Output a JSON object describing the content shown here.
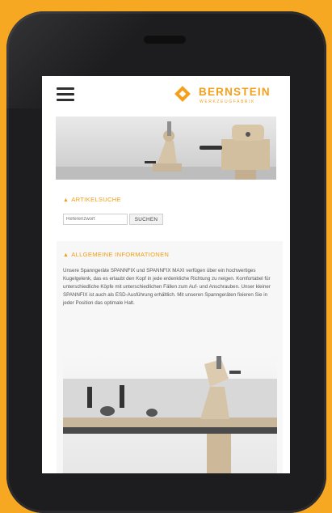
{
  "header": {
    "logo_name": "BERNSTEIN",
    "logo_tagline": "WERKZEUGFABRIK"
  },
  "search": {
    "title": "ARTIKELSUCHE",
    "placeholder": "Referenzwort",
    "button_label": "SUCHEN"
  },
  "info": {
    "title": "ALLGEMEINE INFORMATIONEN",
    "text": "Unsere Spanngeräte SPANNFIX und SPANNFIX MAXI verfügen über ein hochwertiges Kugelgelenk, das es erlaubt den Kopf in jede erdenkliche Richtung zu neigen. Komfortabel für unterschiedliche Köpfe mit unterschiedlichen Fällen zum Auf- und Anschrauben. Unser kleiner SPANNFIX ist auch als ESD-Ausführung erhältlich. Mit unseren Spanngeräten fixieren Sie in jeder Position das optimale Halt."
  },
  "colors": {
    "accent": "#f5a01b",
    "background": "#f7a823",
    "phone": "#1d1d1f"
  },
  "icons": [
    "menu-icon",
    "bernstein-logo-icon",
    "caret-up-icon"
  ]
}
